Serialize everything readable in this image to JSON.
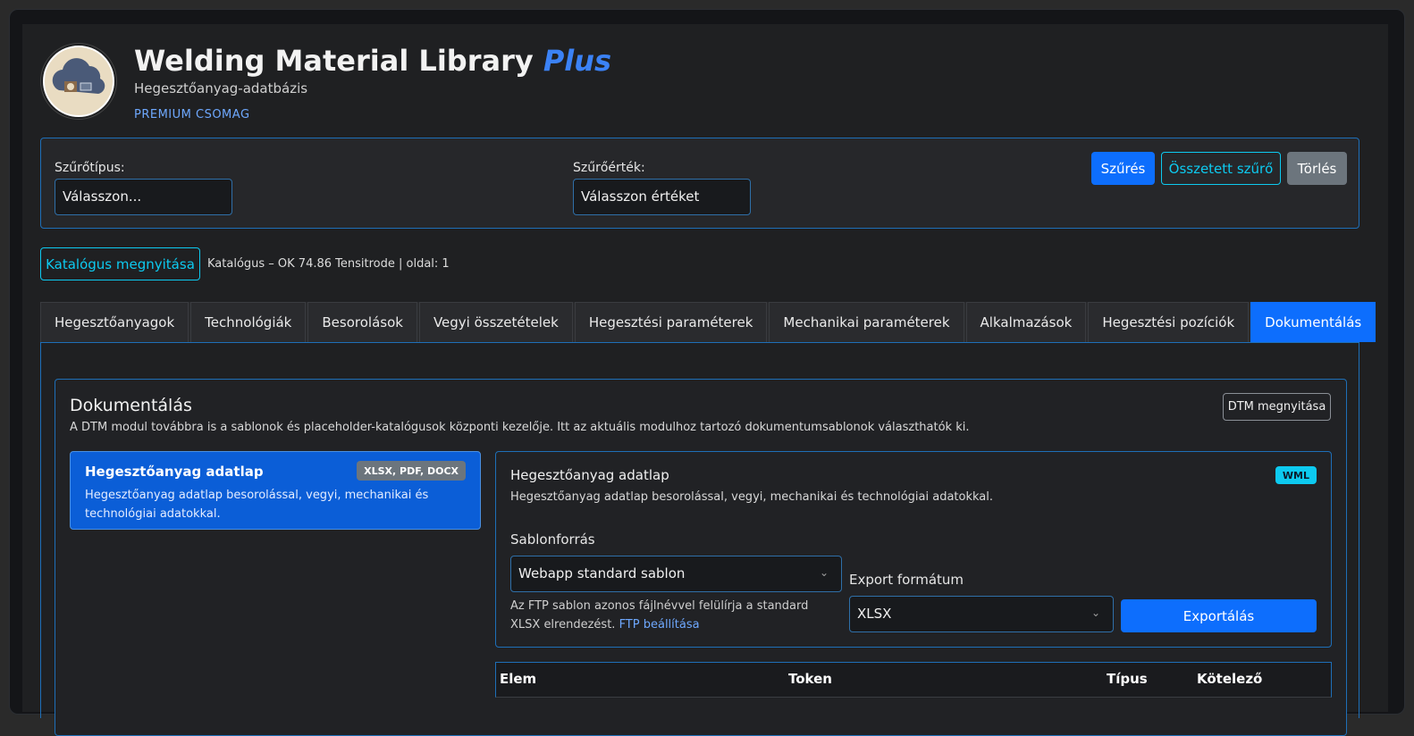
{
  "header": {
    "title_main": "Welding Material Library",
    "title_accent": "Plus",
    "subtitle": "Hegesztőanyag-adatbázis",
    "package": "PREMIUM CSOMAG"
  },
  "filter": {
    "type_label": "Szűrőtípus:",
    "type_value": "Válasszon...",
    "value_label": "Szűrőérték:",
    "value_value": "Válasszon értéket",
    "filter_button": "Szűrés",
    "compound_button": "Összetett szűrő",
    "clear_button": "Törlés"
  },
  "catalog": {
    "open_button": "Katalógus megnyitása",
    "info": "Katalógus – OK 74.86 Tensitrode | oldal: 1"
  },
  "tabs": [
    {
      "label": "Hegesztőanyagok"
    },
    {
      "label": "Technológiák"
    },
    {
      "label": "Besorolások"
    },
    {
      "label": "Vegyi összetételek"
    },
    {
      "label": "Hegesztési paraméterek"
    },
    {
      "label": "Mechanikai paraméterek"
    },
    {
      "label": "Alkalmazások"
    },
    {
      "label": "Hegesztési pozíciók"
    },
    {
      "label": "Dokumentálás"
    }
  ],
  "documentation": {
    "title": "Dokumentálás",
    "description": "A DTM modul továbbra is a sablonok és placeholder-katalógusok központi kezelője. Itt az aktuális modulhoz tartozó dokumentumsablonok választhatók ki.",
    "dtm_button": "DTM megnyitása",
    "template_item": {
      "name": "Hegesztőanyag adatlap",
      "formats": "XLSX, PDF, DOCX",
      "description": "Hegesztőanyag adatlap besorolással, vegyi, mechanikai és technológiai adatokkal."
    },
    "detail": {
      "title": "Hegesztőanyag adatlap",
      "badge": "WML",
      "description": "Hegesztőanyag adatlap besorolással, vegyi, mechanikai és technológiai adatokkal.",
      "source_label": "Sablonforrás",
      "source_value": "Webapp standard sablon",
      "help_text": "Az FTP sablon azonos fájlnévvel felülírja a standard XLSX elrendezést.",
      "help_link": "FTP beállítása",
      "export_label": "Export formátum",
      "export_value": "XLSX",
      "export_button": "Exportálás"
    },
    "table_headers": {
      "elem": "Elem",
      "token": "Token",
      "tipus": "Típus",
      "kotelezo": "Kötelező"
    }
  }
}
